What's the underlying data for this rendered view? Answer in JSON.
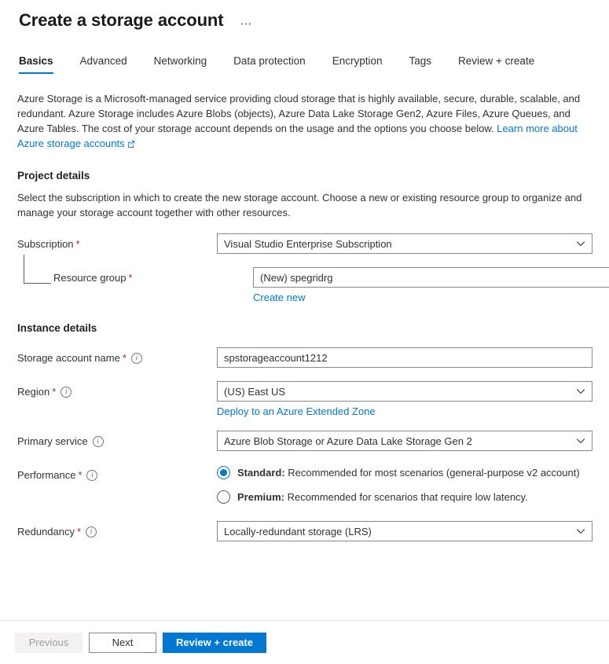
{
  "header": {
    "title": "Create a storage account",
    "more_label": "⋯"
  },
  "tabs": [
    {
      "label": "Basics",
      "active": true
    },
    {
      "label": "Advanced",
      "active": false
    },
    {
      "label": "Networking",
      "active": false
    },
    {
      "label": "Data protection",
      "active": false
    },
    {
      "label": "Encryption",
      "active": false
    },
    {
      "label": "Tags",
      "active": false
    },
    {
      "label": "Review + create",
      "active": false
    }
  ],
  "intro": {
    "text": "Azure Storage is a Microsoft-managed service providing cloud storage that is highly available, secure, durable, scalable, and redundant. Azure Storage includes Azure Blobs (objects), Azure Data Lake Storage Gen2, Azure Files, Azure Queues, and Azure Tables. The cost of your storage account depends on the usage and the options you choose below. ",
    "link_text": "Learn more about Azure storage accounts",
    "link_icon": "external-link-icon"
  },
  "project_details": {
    "title": "Project details",
    "description": "Select the subscription in which to create the new storage account. Choose a new or existing resource group to organize and manage your storage account together with other resources.",
    "subscription": {
      "label": "Subscription",
      "required": "*",
      "value": "Visual Studio Enterprise Subscription",
      "icon": "chevron-down-icon"
    },
    "resource_group": {
      "label": "Resource group",
      "required": "*",
      "value": "(New) spegridrg",
      "icon": "chevron-down-icon",
      "create_new_label": "Create new"
    }
  },
  "instance_details": {
    "title": "Instance details",
    "storage_account_name": {
      "label": "Storage account name",
      "required": "*",
      "info": "info-icon",
      "value": "spstorageaccount1212",
      "placeholder": ""
    },
    "region": {
      "label": "Region",
      "required": "*",
      "info": "info-icon",
      "value": "(US) East US",
      "icon": "chevron-down-icon",
      "sublink": "Deploy to an Azure Extended Zone"
    },
    "primary_service": {
      "label": "Primary service",
      "info": "info-icon",
      "value": "Azure Blob Storage or Azure Data Lake Storage Gen 2",
      "icon": "chevron-down-icon"
    },
    "performance": {
      "label": "Performance",
      "required": "*",
      "info": "info-icon",
      "options": [
        {
          "name": "Standard:",
          "description": " Recommended for most scenarios (general-purpose v2 account)",
          "selected": true
        },
        {
          "name": "Premium:",
          "description": " Recommended for scenarios that require low latency.",
          "selected": false
        }
      ]
    },
    "redundancy": {
      "label": "Redundancy",
      "required": "*",
      "info": "info-icon",
      "value": "Locally-redundant storage (LRS)",
      "icon": "chevron-down-icon"
    }
  },
  "footer": {
    "previous_label": "Previous",
    "next_label": "Next",
    "review_create_label": "Review + create"
  },
  "colors": {
    "accent": "#0078d4",
    "link": "#0078d4",
    "required": "#a4262c",
    "border": "#8a8886",
    "text": "#323130"
  }
}
